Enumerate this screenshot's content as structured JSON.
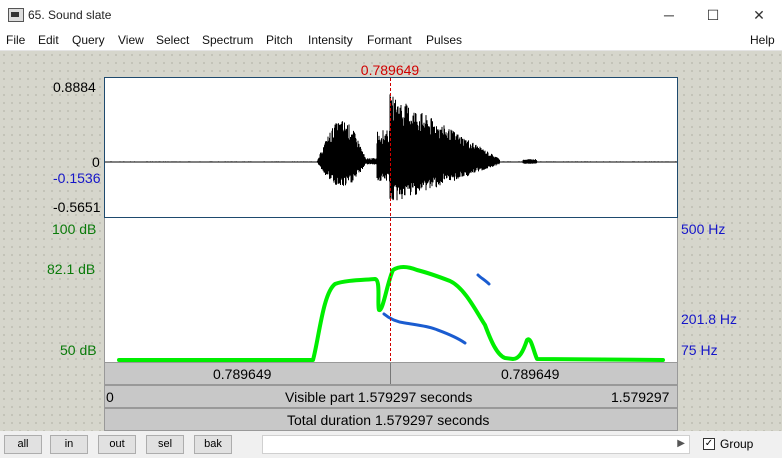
{
  "window": {
    "title": "65. Sound slate",
    "minimize_glyph": "─",
    "maximize_glyph": "☐",
    "close_glyph": "✕"
  },
  "menu": {
    "items": [
      "File",
      "Edit",
      "Query",
      "View",
      "Select",
      "Spectrum",
      "Pitch",
      "Intensity",
      "Formant",
      "Pulses"
    ],
    "help": "Help"
  },
  "cursor": {
    "time_label": "0.789649",
    "time_s": 0.789649
  },
  "waveform": {
    "y_max": "0.8884",
    "y_zero": "0",
    "y_cursor": "-0.1536",
    "y_min": "-0.5651"
  },
  "spectrogram": {
    "db_top": "100 dB",
    "db_mid": "82.1 dB",
    "db_bottom": "50 dB",
    "hz_top": "500 Hz",
    "hz_cursor": "201.8 Hz",
    "hz_bottom": "75 Hz"
  },
  "time_bars": {
    "left_segment": "0.789649",
    "right_segment": "0.789649",
    "visible_start": "0",
    "visible_label": "Visible part 1.579297 seconds",
    "visible_end": "1.579297",
    "total_label": "Total duration 1.579297 seconds"
  },
  "buttons": {
    "all": "all",
    "in": "in",
    "out": "out",
    "sel": "sel",
    "bak": "bak"
  },
  "group": {
    "label": "Group",
    "checked": true,
    "check_glyph": "✓"
  },
  "colors": {
    "intensity": "#00ee00",
    "pitch": "#1a5cd0",
    "cursor": "#d00000",
    "wave": "#000000"
  }
}
